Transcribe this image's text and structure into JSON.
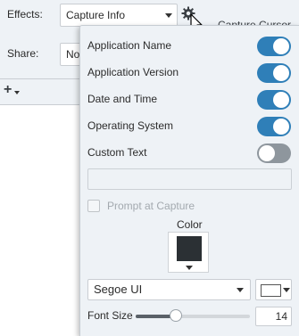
{
  "properties": {
    "effects_label": "Effects:",
    "effects_value": "Capture Info",
    "share_label": "Share:",
    "share_value": "No",
    "right_cut_text": "Capture Cursor",
    "add_button": "+"
  },
  "popup": {
    "toggles": [
      {
        "label": "Application Name",
        "on": true
      },
      {
        "label": "Application Version",
        "on": true
      },
      {
        "label": "Date and Time",
        "on": true
      },
      {
        "label": "Operating System",
        "on": true
      },
      {
        "label": "Custom Text",
        "on": false
      }
    ],
    "custom_text_value": "",
    "prompt_label": "Prompt at Capture",
    "prompt_checked": false,
    "color_label": "Color",
    "font_value": "Segoe UI",
    "font_size_label": "Font Size",
    "font_size_value": "14",
    "font_size_slider_fraction": 0.35
  },
  "colors": {
    "accent": "#2f7fb8",
    "toggle_off": "#8e969d",
    "selected_color": "#2b3034",
    "panel_bg": "#eef2f6"
  },
  "icons": [
    "gear-icon",
    "mouse-cursor-icon",
    "chevron-down-icon",
    "plus-icon"
  ]
}
